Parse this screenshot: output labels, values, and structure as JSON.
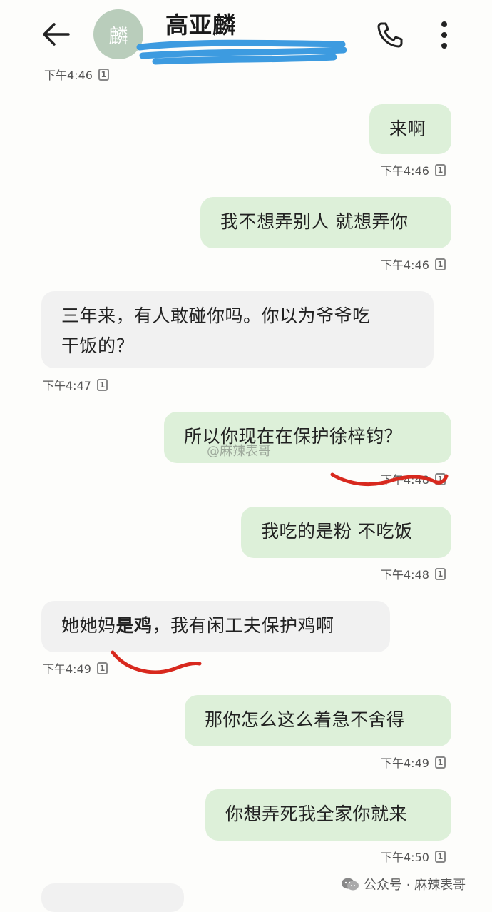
{
  "header": {
    "avatar_text": "麟",
    "contact_name": "高亚麟"
  },
  "top_time": "下午4:46",
  "sim_label": "1",
  "messages": [
    {
      "text": "来啊",
      "time": "下午4:46"
    },
    {
      "text": "我不想弄别人 就想弄你",
      "time": "下午4:46"
    },
    {
      "line1": "三年来，有人敢碰你吗。你以为爷爷吃",
      "line2": "干饭的？",
      "time": "下午4:47"
    },
    {
      "text": "所以你现在在保护徐梓钧？",
      "time": "下午4:48"
    },
    {
      "text": "我吃的是粉 不吃饭",
      "time": "下午4:48"
    },
    {
      "pre": "她她妈",
      "bold": "是鸡",
      "post": "，我有闲工夫保护鸡啊",
      "time": "下午4:49"
    },
    {
      "text": "那你怎么这么着急不舍得",
      "time": "下午4:49"
    },
    {
      "text": "你想弄死我全家你就来",
      "time": "下午4:50"
    }
  ],
  "watermark": "@麻辣表哥",
  "footer": "公众号 · 麻辣表哥",
  "colors": {
    "outgoing": "#ddf0d9",
    "incoming": "#f1f1f1",
    "scribble_blue": "#3d9be0",
    "red_mark": "#d8291e"
  }
}
